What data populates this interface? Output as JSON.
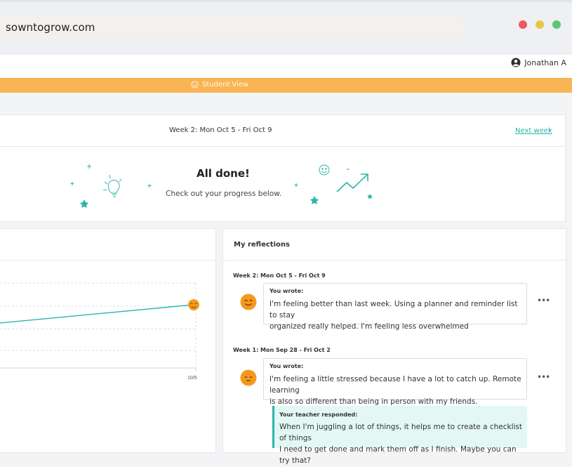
{
  "browser": {
    "url": "sowntogrow.com",
    "window_controls": [
      {
        "name": "close",
        "color": "#ef5b5b"
      },
      {
        "name": "minimize",
        "color": "#e9c646"
      },
      {
        "name": "maximize",
        "color": "#5cc770"
      }
    ]
  },
  "header": {
    "user_name": "Jonathan A",
    "student_view_label": "Student View"
  },
  "week_nav": {
    "title": "Week 2: Mon Oct 5 - Fri Oct 9",
    "next_label": "Next week"
  },
  "completion": {
    "headline": "All done!",
    "subtext": "Check out your progress below."
  },
  "chart": {
    "tick_label": "10/5",
    "chart_data": {
      "type": "line",
      "x": [
        "10/5"
      ],
      "marker": "smiling-face"
    }
  },
  "reflections": {
    "title": "My reflections",
    "entries": [
      {
        "week": "Week 2: Mon Oct 5 - Fri Oct 9",
        "label": "You wrote:",
        "text_line1": "I'm feeling better than last week. Using a planner and reminder list to stay",
        "text_line2": "organized really helped. I'm feeling less overwhelmed",
        "mood": "smiling-face-icon"
      },
      {
        "week": "Week 1: Mon Sep 28 - Fri Oct 2",
        "label": "You wrote:",
        "text_line1": "I'm feeling a little stressed because I have a lot to catch up. Remote learning",
        "text_line2": "is also so different than being in person with my friends.",
        "mood": "neutral-face-icon",
        "teacher_response": {
          "label": "Your teacher responded:",
          "text_line1": "When I'm juggling a lot of things, it helps me to create a checklist of things",
          "text_line2": "I need to get done and mark them off as I finish. Maybe you can try that?"
        }
      }
    ],
    "more_label": "•••"
  },
  "colors": {
    "accent_teal": "#2ab6a8",
    "student_bar": "#f9b453",
    "face": "#f39a1e"
  }
}
